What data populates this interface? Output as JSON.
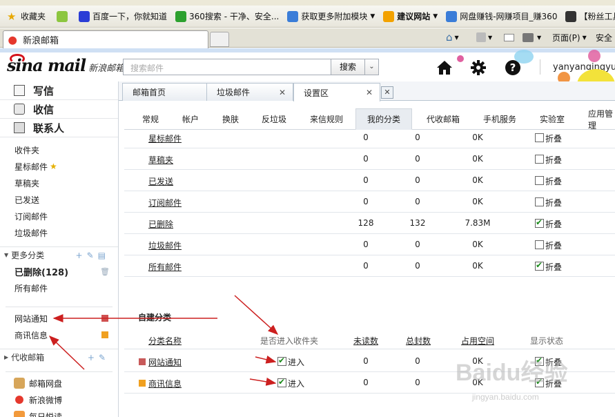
{
  "browser": {
    "favbar": [
      {
        "label": "收藏夹",
        "icon": "star-icon"
      },
      {
        "label": "百度一下，你就知道",
        "icon": "baidu-icon"
      },
      {
        "label": "360搜索 - 干净、安全...",
        "icon": "360-icon"
      },
      {
        "label": "获取更多附加模块",
        "icon": "ie-icon"
      },
      {
        "label": "建议网站",
        "icon": "suggest-icon"
      },
      {
        "label": "网盘赚钱-网赚项目_赚360",
        "icon": "ie-icon"
      },
      {
        "label": "【粉丝工具",
        "icon": "tool-icon"
      }
    ],
    "tab_title": "新浪邮箱",
    "commands": {
      "page": "页面(P)",
      "safety": "安全"
    }
  },
  "header": {
    "logo_text": "sina mail",
    "logo_cn": "新浪邮箱",
    "search_placeholder": "搜索邮件",
    "search_button": "搜索",
    "username": "yanyanqingyu"
  },
  "sidebar": {
    "main": [
      {
        "label": "写信",
        "icon": "compose-icon"
      },
      {
        "label": "收信",
        "icon": "inbox-icon"
      },
      {
        "label": "联系人",
        "icon": "contacts-icon"
      }
    ],
    "folders": [
      "收件夹",
      "星标邮件",
      "草稿夹",
      "已发送",
      "订阅邮件",
      "垃圾邮件"
    ],
    "more_header": "更多分类",
    "more_items": [
      "已删除(128)",
      "所有邮件"
    ],
    "custom_items": [
      {
        "label": "网站通知",
        "color": "#d05050"
      },
      {
        "label": "商讯信息",
        "color": "#f0a020"
      }
    ],
    "proxy_header": "代收邮箱",
    "apps": [
      {
        "label": "邮箱网盘",
        "icon": "netdisk-icon"
      },
      {
        "label": "新浪微博",
        "icon": "weibo-icon"
      },
      {
        "label": "每日悦读",
        "icon": "reading-icon"
      }
    ]
  },
  "content_tabs": [
    {
      "label": "邮箱首页"
    },
    {
      "label": "垃圾邮件"
    },
    {
      "label": "设置区"
    }
  ],
  "settings_tabs": [
    "常规",
    "帐户",
    "换肤",
    "反垃圾",
    "来信规则",
    "我的分类",
    "代收邮箱",
    "手机服务",
    "实验室",
    "应用管理"
  ],
  "system_folders": [
    {
      "name": "星标邮件",
      "unread": "0",
      "total": "0",
      "size": "0K",
      "fold_label": "折叠",
      "fold": false
    },
    {
      "name": "草稿夹",
      "unread": "0",
      "total": "0",
      "size": "0K",
      "fold_label": "折叠",
      "fold": false
    },
    {
      "name": "已发送",
      "unread": "0",
      "total": "0",
      "size": "0K",
      "fold_label": "折叠",
      "fold": false
    },
    {
      "name": "订阅邮件",
      "unread": "0",
      "total": "0",
      "size": "0K",
      "fold_label": "折叠",
      "fold": false
    },
    {
      "name": "已删除",
      "unread": "128",
      "total": "132",
      "size": "7.83M",
      "fold_label": "折叠",
      "fold": true
    },
    {
      "name": "垃圾邮件",
      "unread": "0",
      "total": "0",
      "size": "0K",
      "fold_label": "折叠",
      "fold": false
    },
    {
      "name": "所有邮件",
      "unread": "0",
      "total": "0",
      "size": "0K",
      "fold_label": "折叠",
      "fold": true
    }
  ],
  "custom_section": {
    "title": "自建分类",
    "headers": {
      "name": "分类名称",
      "inbox": "是否进入收件夹",
      "unread": "未读数",
      "total": "总封数",
      "size": "占用空间",
      "display": "显示状态"
    },
    "rows": [
      {
        "name": "网站通知",
        "color": "#c85a5a",
        "inbox_label": "进入",
        "unread": "0",
        "total": "0",
        "size": "0K",
        "fold_label": "折叠"
      },
      {
        "name": "商讯信息",
        "color": "#f0a020",
        "inbox_label": "进入",
        "unread": "0",
        "total": "0",
        "size": "0K",
        "fold_label": "折叠"
      }
    ]
  },
  "watermark": {
    "brand": "Baidu经验",
    "url": "jingyan.baidu.com"
  }
}
